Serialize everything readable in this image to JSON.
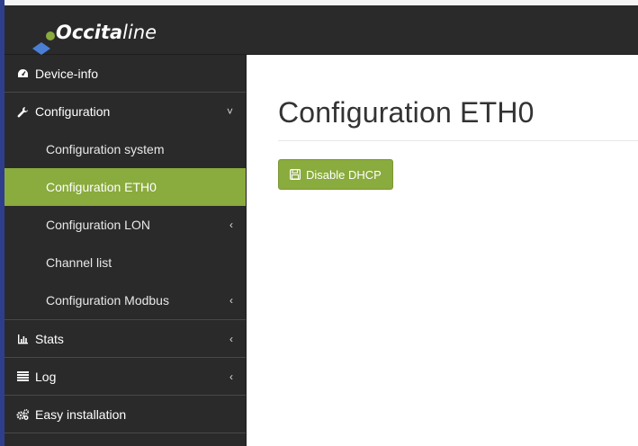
{
  "app": {
    "logo_prefix": "O",
    "logo_bold": "ccita",
    "logo_light": "line"
  },
  "sidebar": {
    "items": [
      {
        "label": "Device-info",
        "icon": "dashboard-icon"
      },
      {
        "label": "Configuration",
        "icon": "wrench-icon",
        "chevron": "˅",
        "expanded": true,
        "children": [
          {
            "label": "Configuration system"
          },
          {
            "label": "Configuration ETH0",
            "active": true
          },
          {
            "label": "Configuration LON",
            "chevron": "‹"
          },
          {
            "label": "Channel list"
          },
          {
            "label": "Configuration Modbus",
            "chevron": "‹"
          }
        ]
      },
      {
        "label": "Stats",
        "icon": "bar-chart-icon",
        "chevron": "‹"
      },
      {
        "label": "Log",
        "icon": "list-icon",
        "chevron": "‹"
      },
      {
        "label": "Easy installation",
        "icon": "cogs-icon"
      }
    ]
  },
  "main": {
    "title": "Configuration ETH0",
    "button_label": "Disable DHCP",
    "button_icon": "floppy-disk-icon"
  },
  "colors": {
    "accent": "#8aab3d",
    "sidebar_bg": "#2a2a2a",
    "topbar_bg": "#2a2a2a"
  }
}
